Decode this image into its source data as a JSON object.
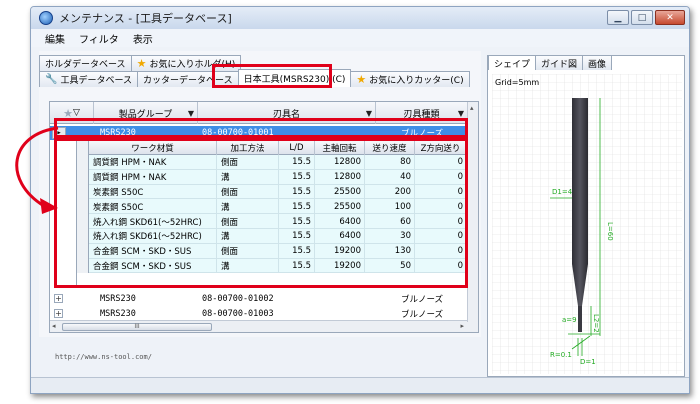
{
  "window": {
    "title": "メンテナンス - [工具データベース]",
    "controls": [
      "minimize-icon",
      "maximize-icon",
      "close-icon"
    ]
  },
  "menu": [
    "編集",
    "フィルタ",
    "表示"
  ],
  "tabs_row1": [
    "ホルダデータベース",
    "お気に入りホルダ(H)"
  ],
  "tabs_row2": [
    "工具データベース",
    "カッターデータベース",
    "日本工具(MSRS230) (C)",
    "お気に入りカッター(C)"
  ],
  "grid": {
    "columns": [
      "製品グループ",
      "刃具名",
      "刃具種類"
    ],
    "selected_row": {
      "group": "MSRS230",
      "name": "08-00700-01001",
      "type": "ブルノーズ"
    },
    "other_rows": [
      {
        "group": "MSRS230",
        "name": "08-00700-01002",
        "type": "ブルノーズ"
      },
      {
        "group": "MSRS230",
        "name": "08-00700-01003",
        "type": "ブルノーズ"
      }
    ],
    "scroll_label": "III"
  },
  "subgrid": {
    "columns": [
      "ワーク材質",
      "加工方法",
      "L/D",
      "主軸回転",
      "送り速度",
      "Z方向送り"
    ],
    "rows": [
      [
        "調質鋼 HPM・NAK",
        "側面",
        "15.5",
        "12800",
        "80",
        "0"
      ],
      [
        "調質鋼 HPM・NAK",
        "溝",
        "15.5",
        "12800",
        "40",
        "0"
      ],
      [
        "炭素鋼 S50C",
        "側面",
        "15.5",
        "25500",
        "200",
        "0"
      ],
      [
        "炭素鋼 S50C",
        "溝",
        "15.5",
        "25500",
        "100",
        "0"
      ],
      [
        "焼入れ鋼 SKD61(～52HRC)",
        "側面",
        "15.5",
        "6400",
        "60",
        "0"
      ],
      [
        "焼入れ鋼 SKD61(～52HRC)",
        "溝",
        "15.5",
        "6400",
        "30",
        "0"
      ],
      [
        "合金鋼 SCM・SKD・SUS",
        "側面",
        "15.5",
        "19200",
        "130",
        "0"
      ],
      [
        "合金鋼 SCM・SKD・SUS",
        "溝",
        "15.5",
        "19200",
        "50",
        "0"
      ]
    ]
  },
  "right_panel": {
    "tabs": [
      "シェイプ",
      "ガイド図",
      "画像"
    ],
    "grid_label": "Grid=5mm",
    "dims": {
      "d1": "D1=4",
      "l": "L=60",
      "a": "a=9",
      "l2": "L2=2",
      "r": "R=0.1",
      "d": "D=1"
    }
  },
  "footer_url": "http://www.ns-tool.com/",
  "colors": {
    "accent_red": "#e0001a",
    "selection_blue": "#3f8ee6",
    "light_cyan_row": "#e8fafc"
  }
}
